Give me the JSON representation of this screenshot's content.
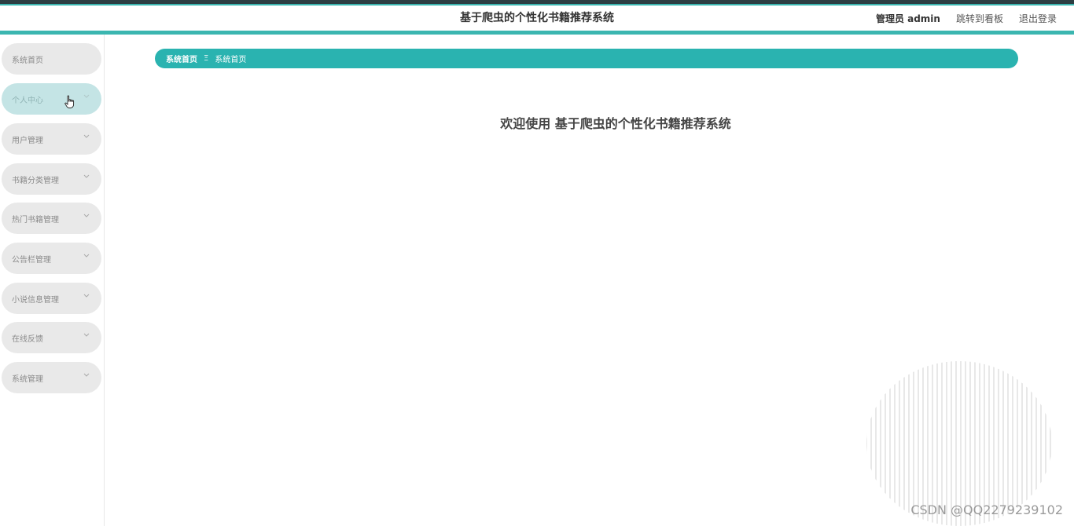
{
  "header": {
    "title": "基于爬虫的个性化书籍推荐系统",
    "admin_label": "管理员 admin",
    "dashboard_link": "跳转到看板",
    "logout_link": "退出登录"
  },
  "sidebar": {
    "items": [
      {
        "label": "系统首页",
        "has_chevron": false
      },
      {
        "label": "个人中心",
        "has_chevron": true
      },
      {
        "label": "用户管理",
        "has_chevron": true
      },
      {
        "label": "书籍分类管理",
        "has_chevron": true
      },
      {
        "label": "热门书籍管理",
        "has_chevron": true
      },
      {
        "label": "公告栏管理",
        "has_chevron": true
      },
      {
        "label": "小说信息管理",
        "has_chevron": true
      },
      {
        "label": "在线反馈",
        "has_chevron": true
      },
      {
        "label": "系统管理",
        "has_chevron": true
      }
    ]
  },
  "breadcrumb": {
    "first": "系统首页",
    "separator": "Ξ",
    "current": "系统首页"
  },
  "main": {
    "welcome": "欢迎使用 基于爬虫的个性化书籍推荐系统"
  },
  "watermark": "CSDN @QQ2279239102",
  "colors": {
    "accent": "#2ab3b0",
    "top_stripe": "#2c3e42",
    "sidebar_item_bg": "#e9e9e9",
    "sidebar_active_bg": "#c4e4e5"
  }
}
